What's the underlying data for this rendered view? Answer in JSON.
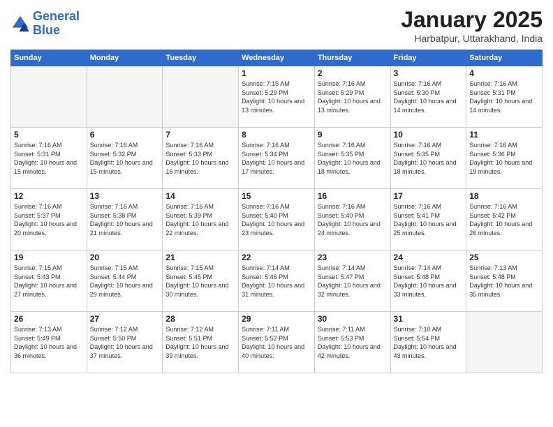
{
  "header": {
    "logo_line1": "General",
    "logo_line2": "Blue",
    "month": "January 2025",
    "location": "Harbatpur, Uttarakhand, India"
  },
  "weekdays": [
    "Sunday",
    "Monday",
    "Tuesday",
    "Wednesday",
    "Thursday",
    "Friday",
    "Saturday"
  ],
  "weeks": [
    [
      {
        "day": "",
        "info": ""
      },
      {
        "day": "",
        "info": ""
      },
      {
        "day": "",
        "info": ""
      },
      {
        "day": "1",
        "info": "Sunrise: 7:15 AM\nSunset: 5:29 PM\nDaylight: 10 hours\nand 13 minutes."
      },
      {
        "day": "2",
        "info": "Sunrise: 7:16 AM\nSunset: 5:29 PM\nDaylight: 10 hours\nand 13 minutes."
      },
      {
        "day": "3",
        "info": "Sunrise: 7:16 AM\nSunset: 5:30 PM\nDaylight: 10 hours\nand 14 minutes."
      },
      {
        "day": "4",
        "info": "Sunrise: 7:16 AM\nSunset: 5:31 PM\nDaylight: 10 hours\nand 14 minutes."
      }
    ],
    [
      {
        "day": "5",
        "info": "Sunrise: 7:16 AM\nSunset: 5:31 PM\nDaylight: 10 hours\nand 15 minutes."
      },
      {
        "day": "6",
        "info": "Sunrise: 7:16 AM\nSunset: 5:32 PM\nDaylight: 10 hours\nand 15 minutes."
      },
      {
        "day": "7",
        "info": "Sunrise: 7:16 AM\nSunset: 5:33 PM\nDaylight: 10 hours\nand 16 minutes."
      },
      {
        "day": "8",
        "info": "Sunrise: 7:16 AM\nSunset: 5:34 PM\nDaylight: 10 hours\nand 17 minutes."
      },
      {
        "day": "9",
        "info": "Sunrise: 7:16 AM\nSunset: 5:35 PM\nDaylight: 10 hours\nand 18 minutes."
      },
      {
        "day": "10",
        "info": "Sunrise: 7:16 AM\nSunset: 5:35 PM\nDaylight: 10 hours\nand 18 minutes."
      },
      {
        "day": "11",
        "info": "Sunrise: 7:16 AM\nSunset: 5:36 PM\nDaylight: 10 hours\nand 19 minutes."
      }
    ],
    [
      {
        "day": "12",
        "info": "Sunrise: 7:16 AM\nSunset: 5:37 PM\nDaylight: 10 hours\nand 20 minutes."
      },
      {
        "day": "13",
        "info": "Sunrise: 7:16 AM\nSunset: 5:38 PM\nDaylight: 10 hours\nand 21 minutes."
      },
      {
        "day": "14",
        "info": "Sunrise: 7:16 AM\nSunset: 5:39 PM\nDaylight: 10 hours\nand 22 minutes."
      },
      {
        "day": "15",
        "info": "Sunrise: 7:16 AM\nSunset: 5:40 PM\nDaylight: 10 hours\nand 23 minutes."
      },
      {
        "day": "16",
        "info": "Sunrise: 7:16 AM\nSunset: 5:40 PM\nDaylight: 10 hours\nand 24 minutes."
      },
      {
        "day": "17",
        "info": "Sunrise: 7:16 AM\nSunset: 5:41 PM\nDaylight: 10 hours\nand 25 minutes."
      },
      {
        "day": "18",
        "info": "Sunrise: 7:16 AM\nSunset: 5:42 PM\nDaylight: 10 hours\nand 26 minutes."
      }
    ],
    [
      {
        "day": "19",
        "info": "Sunrise: 7:15 AM\nSunset: 5:43 PM\nDaylight: 10 hours\nand 27 minutes."
      },
      {
        "day": "20",
        "info": "Sunrise: 7:15 AM\nSunset: 5:44 PM\nDaylight: 10 hours\nand 29 minutes."
      },
      {
        "day": "21",
        "info": "Sunrise: 7:15 AM\nSunset: 5:45 PM\nDaylight: 10 hours\nand 30 minutes."
      },
      {
        "day": "22",
        "info": "Sunrise: 7:14 AM\nSunset: 5:46 PM\nDaylight: 10 hours\nand 31 minutes."
      },
      {
        "day": "23",
        "info": "Sunrise: 7:14 AM\nSunset: 5:47 PM\nDaylight: 10 hours\nand 32 minutes."
      },
      {
        "day": "24",
        "info": "Sunrise: 7:14 AM\nSunset: 5:48 PM\nDaylight: 10 hours\nand 33 minutes."
      },
      {
        "day": "25",
        "info": "Sunrise: 7:13 AM\nSunset: 5:48 PM\nDaylight: 10 hours\nand 35 minutes."
      }
    ],
    [
      {
        "day": "26",
        "info": "Sunrise: 7:13 AM\nSunset: 5:49 PM\nDaylight: 10 hours\nand 36 minutes."
      },
      {
        "day": "27",
        "info": "Sunrise: 7:12 AM\nSunset: 5:50 PM\nDaylight: 10 hours\nand 37 minutes."
      },
      {
        "day": "28",
        "info": "Sunrise: 7:12 AM\nSunset: 5:51 PM\nDaylight: 10 hours\nand 39 minutes."
      },
      {
        "day": "29",
        "info": "Sunrise: 7:11 AM\nSunset: 5:52 PM\nDaylight: 10 hours\nand 40 minutes."
      },
      {
        "day": "30",
        "info": "Sunrise: 7:11 AM\nSunset: 5:53 PM\nDaylight: 10 hours\nand 42 minutes."
      },
      {
        "day": "31",
        "info": "Sunrise: 7:10 AM\nSunset: 5:54 PM\nDaylight: 10 hours\nand 43 minutes."
      },
      {
        "day": "",
        "info": ""
      }
    ]
  ]
}
